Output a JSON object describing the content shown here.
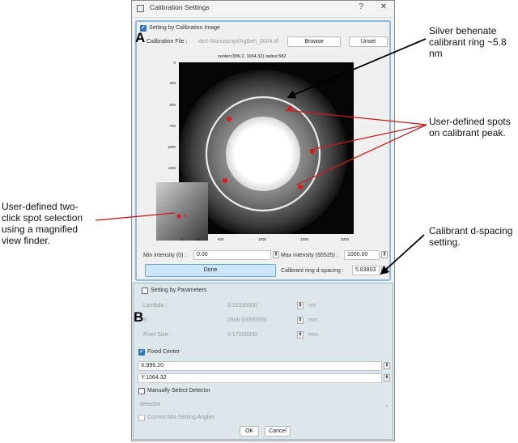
{
  "window": {
    "title": "Calibration Settings",
    "help_glyph": "?",
    "close_glyph": "✕"
  },
  "section_a": {
    "letter": "A",
    "checkbox_label": "Setting by Calibration Image",
    "file_label": "Calibration File :",
    "file_value": "deX-Manuscript/AgBeh_0004.tif",
    "browse_label": "Browse",
    "unset_label": "Unset",
    "plot_caption": "center:(996.2, 1064.32) radius:582",
    "y_ticks": [
      "0",
      "250",
      "500",
      "750",
      "1000",
      "1250",
      "1500",
      "1750",
      "2000"
    ],
    "x_ticks": [
      "0",
      "250",
      "500",
      "1000",
      "1500",
      "2000"
    ],
    "min_intensity_label": "Min intensity (0) :",
    "min_intensity_value": "0.00",
    "max_intensity_label": "Max intensity (65535) :",
    "max_intensity_value": "1000.00",
    "done_label": "Done",
    "dspacing_label": "Calibrant ring d-spacing :",
    "dspacing_value": "5.83803"
  },
  "section_b": {
    "letter": "B",
    "params_label": "Setting by Parameters",
    "lambda_label": "Lambda :",
    "lambda_value": "0.10330000",
    "lambda_unit": "nm",
    "s_label": "S :",
    "s_value": "2500.00000000",
    "s_unit": "mm",
    "pixel_label": "Pixel Size :",
    "pixel_value": "0.17200000",
    "pixel_unit": "mm",
    "fixed_center_label": "Fixed Center",
    "x_value": "X:996.20",
    "y_value": "Y:1064.32",
    "manual_detector_label": "Manually Select Detector",
    "detector_value": "detector",
    "correct_label": "Correct Mis-Setting Angles",
    "ok_label": "OK",
    "cancel_label": "Cancel"
  },
  "annotations": {
    "silver": "Silver behenate calibrant ring ~5.8 nm",
    "spots": "User-defined spots on calibrant peak.",
    "twoclick": "User-defined two-click spot selection using a magnified view finder.",
    "dspacing": "Calibrant d-spacing setting."
  },
  "colors": {
    "spot": "#e0191b",
    "checkbox_accent": "#2b73c8",
    "panel_border": "#86bde0"
  }
}
